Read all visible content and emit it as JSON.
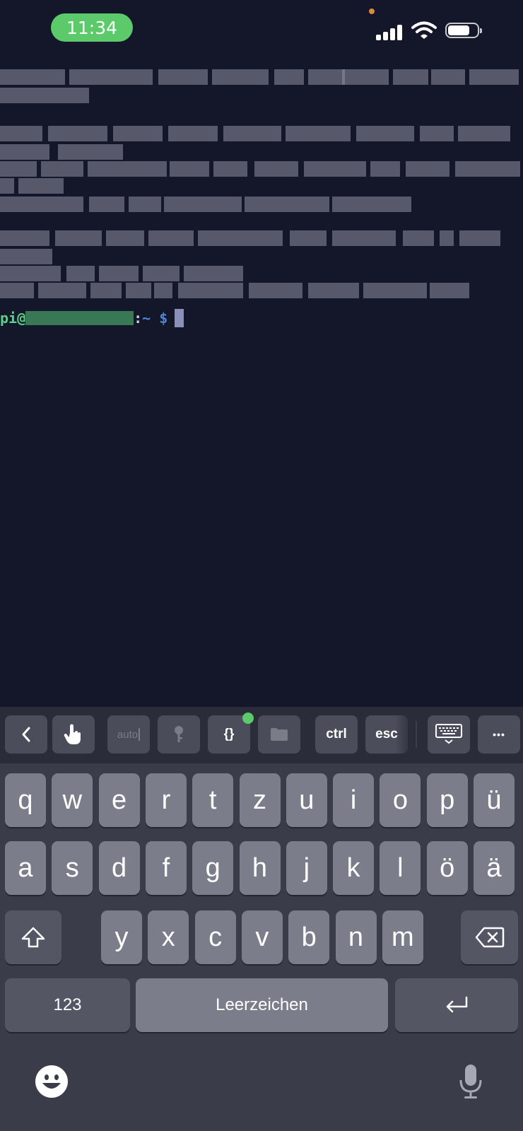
{
  "status_bar": {
    "time": "11:34",
    "signal_bars": 4,
    "battery_level": 0.75,
    "icons": [
      "cellular-signal-icon",
      "wifi-icon",
      "battery-icon"
    ]
  },
  "terminal": {
    "prompt_user": "pi@",
    "prompt_colon": ":",
    "prompt_path": "~",
    "prompt_symbol": "$"
  },
  "toolbar": {
    "back_icon": "chevron-left-icon",
    "touch_icon": "touch-hand-icon",
    "auto_label": "auto",
    "key_icon": "key-icon",
    "braces_label": "{}",
    "folder_icon": "folder-icon",
    "ctrl_label": "ctrl",
    "esc_label": "esc",
    "keyboard_icon": "keyboard-hide-icon",
    "more_label": "•••"
  },
  "keyboard": {
    "row1": [
      "q",
      "w",
      "e",
      "r",
      "t",
      "z",
      "u",
      "i",
      "o",
      "p",
      "ü"
    ],
    "row2": [
      "a",
      "s",
      "d",
      "f",
      "g",
      "h",
      "j",
      "k",
      "l",
      "ö",
      "ä"
    ],
    "row3": [
      "y",
      "x",
      "c",
      "v",
      "b",
      "n",
      "m"
    ],
    "numbers_label": "123",
    "space_label": "Leerzeichen",
    "shift_icon": "shift-icon",
    "delete_icon": "backspace-icon",
    "return_icon": "return-icon",
    "emoji_icon": "emoji-icon",
    "mic_icon": "microphone-icon"
  }
}
